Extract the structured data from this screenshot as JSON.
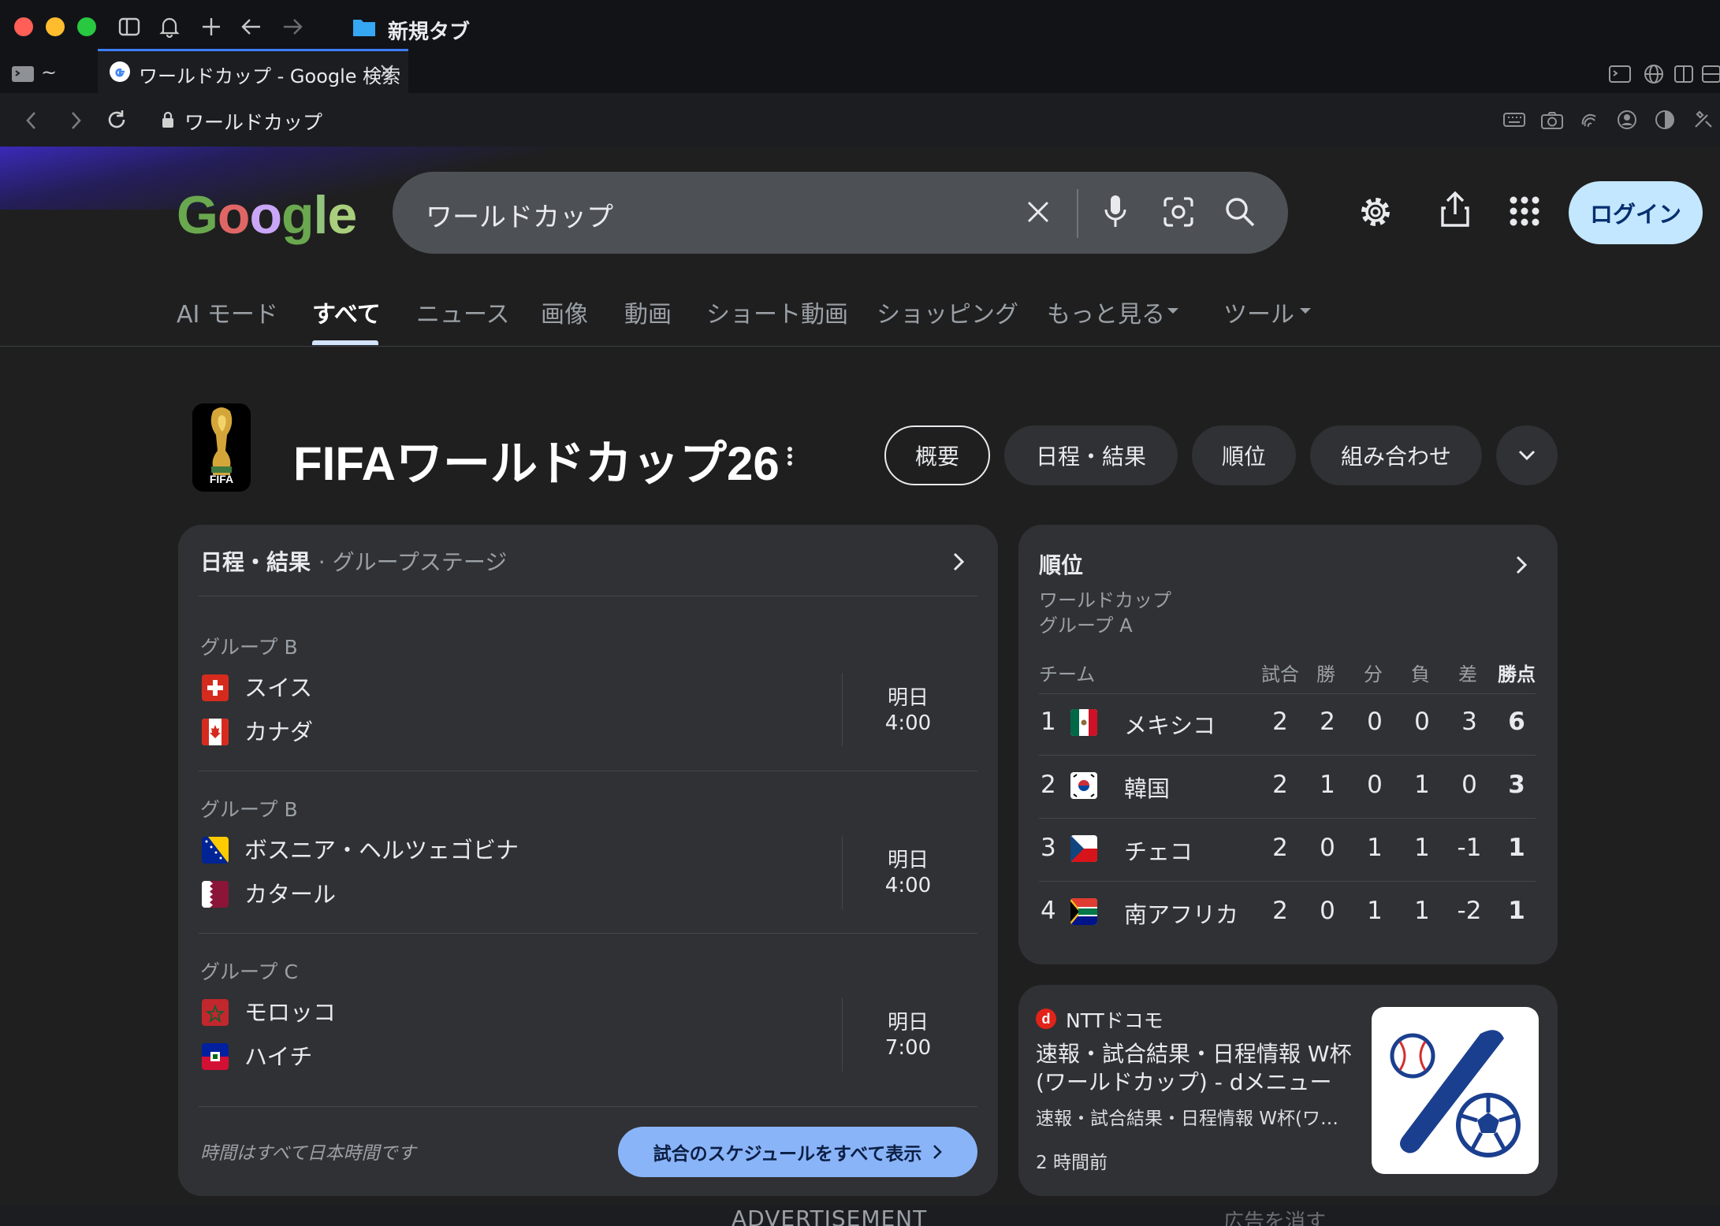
{
  "titlebar": {
    "new_tab_label": "新規タブ"
  },
  "tabs": {
    "terminal_label": "~",
    "active_label": "ワールドカップ - Google 検索"
  },
  "address": {
    "url": "ワールドカップ"
  },
  "search": {
    "query": "ワールドカップ",
    "login_label": "ログイン"
  },
  "nav": {
    "ai": "AI モード",
    "all": "すべて",
    "news": "ニュース",
    "images": "画像",
    "videos": "動画",
    "shorts": "ショート動画",
    "shopping": "ショッピング",
    "more": "もっと見る",
    "tools": "ツール"
  },
  "kp": {
    "logo_text": "FIFA",
    "title": "FIFAワールドカップ26",
    "chips": [
      "概要",
      "日程・結果",
      "順位",
      "組み合わせ"
    ]
  },
  "schedule": {
    "title": "日程・結果",
    "subtitle": "· グループステージ",
    "matches": [
      {
        "group": "グループ B",
        "team1": "スイス",
        "team2": "カナダ",
        "day": "明日",
        "time": "4:00"
      },
      {
        "group": "グループ B",
        "team1": "ボスニア・ヘルツェゴビナ",
        "team2": "カタール",
        "day": "明日",
        "time": "4:00"
      },
      {
        "group": "グループ C",
        "team1": "モロッコ",
        "team2": "ハイチ",
        "day": "明日",
        "time": "7:00"
      }
    ],
    "footer_note": "時間はすべて日本時間です",
    "all_button": "試合のスケジュールをすべて表示"
  },
  "standings": {
    "title": "順位",
    "subtitle1": "ワールドカップ",
    "subtitle2": "グループ A",
    "headers": [
      "チーム",
      "試合",
      "勝",
      "分",
      "負",
      "差",
      "勝点"
    ],
    "rows": [
      {
        "rank": "1",
        "team": "メキシコ",
        "p": "2",
        "w": "2",
        "d": "0",
        "l": "0",
        "gd": "3",
        "pts": "6"
      },
      {
        "rank": "2",
        "team": "韓国",
        "p": "2",
        "w": "1",
        "d": "0",
        "l": "1",
        "gd": "0",
        "pts": "3"
      },
      {
        "rank": "3",
        "team": "チェコ",
        "p": "2",
        "w": "0",
        "d": "1",
        "l": "1",
        "gd": "-1",
        "pts": "1"
      },
      {
        "rank": "4",
        "team": "南アフリカ",
        "p": "2",
        "w": "0",
        "d": "1",
        "l": "1",
        "gd": "-2",
        "pts": "1"
      }
    ]
  },
  "news": {
    "source": "NTTドコモ",
    "title": "速報・試合結果・日程情報 W杯(ワールドカップ) - dメニュー",
    "snippet": "速報・試合結果・日程情報 W杯(ワ…",
    "time": "2 時間前"
  },
  "bottom": {
    "ad_label": "ADVERTISEMENT",
    "hide_ad": "広告を消す"
  },
  "colors": {
    "accent_blue": "#c2e7ff",
    "tab_accent": "#3d7df5",
    "card_bg": "#303134"
  }
}
